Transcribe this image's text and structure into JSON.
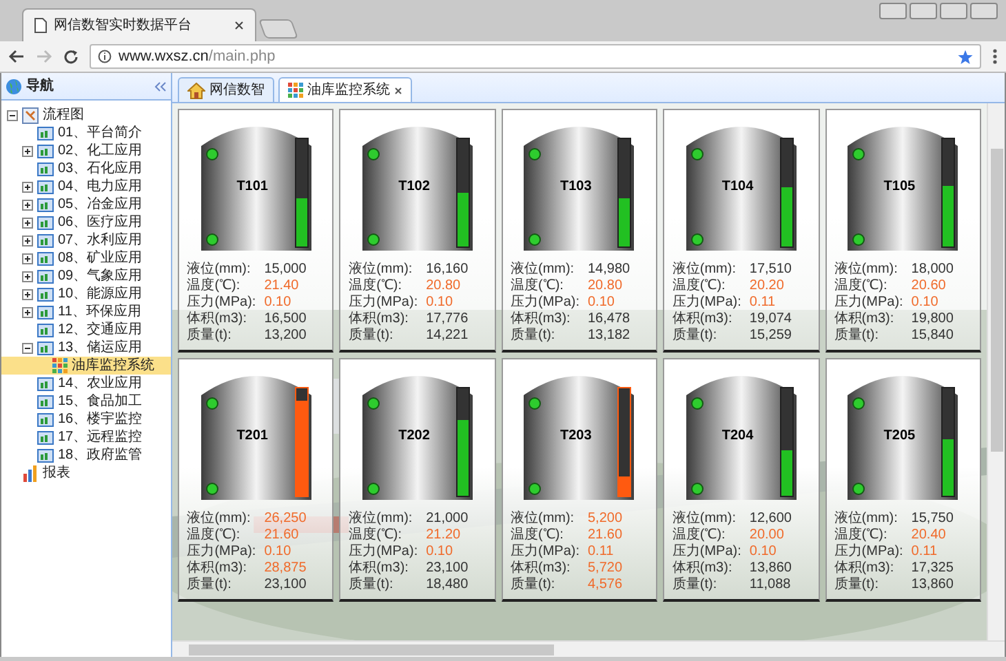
{
  "browser": {
    "tab_title": "网信数智实时数据平台",
    "url_host": "www.wxsz.cn",
    "url_path": "/main.php"
  },
  "sidebar": {
    "title": "导航",
    "tree": [
      {
        "label": "流程图",
        "kind": "flow",
        "expanded": true,
        "selected": false,
        "children": [
          {
            "label": "01、平台简介",
            "kind": "page",
            "selected": false
          },
          {
            "label": "02、化工应用",
            "kind": "page",
            "expanded": false,
            "selected": false
          },
          {
            "label": "03、石化应用",
            "kind": "page",
            "selected": false
          },
          {
            "label": "04、电力应用",
            "kind": "page",
            "expanded": false,
            "selected": false
          },
          {
            "label": "05、冶金应用",
            "kind": "page",
            "expanded": false,
            "selected": false
          },
          {
            "label": "06、医疗应用",
            "kind": "page",
            "expanded": false,
            "selected": false
          },
          {
            "label": "07、水利应用",
            "kind": "page",
            "expanded": false,
            "selected": false
          },
          {
            "label": "08、矿业应用",
            "kind": "page",
            "expanded": false,
            "selected": false
          },
          {
            "label": "09、气象应用",
            "kind": "page",
            "expanded": false,
            "selected": false
          },
          {
            "label": "10、能源应用",
            "kind": "page",
            "expanded": false,
            "selected": false
          },
          {
            "label": "11、环保应用",
            "kind": "page",
            "expanded": false,
            "selected": false
          },
          {
            "label": "12、交通应用",
            "kind": "page",
            "selected": false
          },
          {
            "label": "13、储运应用",
            "kind": "page",
            "expanded": true,
            "selected": false,
            "children": [
              {
                "label": "油库监控系统",
                "kind": "grid",
                "selected": true
              }
            ]
          },
          {
            "label": "14、农业应用",
            "kind": "page",
            "selected": false
          },
          {
            "label": "15、食品加工",
            "kind": "page",
            "selected": false
          },
          {
            "label": "16、楼宇监控",
            "kind": "page",
            "selected": false
          },
          {
            "label": "17、远程监控",
            "kind": "page",
            "selected": false
          },
          {
            "label": "18、政府监管",
            "kind": "page",
            "selected": false
          }
        ]
      },
      {
        "label": "报表",
        "kind": "report",
        "selected": false
      }
    ]
  },
  "tabs": [
    {
      "label": "网信数智",
      "kind": "home",
      "selected": false
    },
    {
      "label": "油库监控系统",
      "kind": "grid",
      "selected": true
    }
  ],
  "tanks": [
    {
      "name": "T101",
      "level": 0.45,
      "alarm": false,
      "readings": [
        {
          "label": "液位(mm):",
          "value": "15,000",
          "alert": false
        },
        {
          "label": "温度(℃):",
          "value": "21.40",
          "alert": true
        },
        {
          "label": "压力(MPa):",
          "value": "0.10",
          "alert": true
        },
        {
          "label": "体积(m3):",
          "value": "16,500",
          "alert": false
        },
        {
          "label": "质量(t):",
          "value": "13,200",
          "alert": false
        }
      ]
    },
    {
      "name": "T102",
      "level": 0.5,
      "alarm": false,
      "readings": [
        {
          "label": "液位(mm):",
          "value": "16,160",
          "alert": false
        },
        {
          "label": "温度(℃):",
          "value": "20.80",
          "alert": true
        },
        {
          "label": "压力(MPa):",
          "value": "0.10",
          "alert": true
        },
        {
          "label": "体积(m3):",
          "value": "17,776",
          "alert": false
        },
        {
          "label": "质量(t):",
          "value": "14,221",
          "alert": false
        }
      ]
    },
    {
      "name": "T103",
      "level": 0.45,
      "alarm": false,
      "readings": [
        {
          "label": "液位(mm):",
          "value": "14,980",
          "alert": false
        },
        {
          "label": "温度(℃):",
          "value": "20.80",
          "alert": true
        },
        {
          "label": "压力(MPa):",
          "value": "0.10",
          "alert": true
        },
        {
          "label": "体积(m3):",
          "value": "16,478",
          "alert": false
        },
        {
          "label": "质量(t):",
          "value": "13,182",
          "alert": false
        }
      ]
    },
    {
      "name": "T104",
      "level": 0.55,
      "alarm": false,
      "readings": [
        {
          "label": "液位(mm):",
          "value": "17,510",
          "alert": false
        },
        {
          "label": "温度(℃):",
          "value": "20.20",
          "alert": true
        },
        {
          "label": "压力(MPa):",
          "value": "0.11",
          "alert": true
        },
        {
          "label": "体积(m3):",
          "value": "19,074",
          "alert": false
        },
        {
          "label": "质量(t):",
          "value": "15,259",
          "alert": false
        }
      ]
    },
    {
      "name": "T105",
      "level": 0.57,
      "alarm": false,
      "readings": [
        {
          "label": "液位(mm):",
          "value": "18,000",
          "alert": false
        },
        {
          "label": "温度(℃):",
          "value": "20.60",
          "alert": true
        },
        {
          "label": "压力(MPa):",
          "value": "0.10",
          "alert": true
        },
        {
          "label": "体积(m3):",
          "value": "19,800",
          "alert": false
        },
        {
          "label": "质量(t):",
          "value": "15,840",
          "alert": false
        }
      ]
    },
    {
      "name": "T201",
      "level": 0.88,
      "alarm": true,
      "readings": [
        {
          "label": "液位(mm):",
          "value": "26,250",
          "alert": true
        },
        {
          "label": "温度(℃):",
          "value": "21.60",
          "alert": true
        },
        {
          "label": "压力(MPa):",
          "value": "0.10",
          "alert": true
        },
        {
          "label": "体积(m3):",
          "value": "28,875",
          "alert": true
        },
        {
          "label": "质量(t):",
          "value": "23,100",
          "alert": false
        }
      ]
    },
    {
      "name": "T202",
      "level": 0.7,
      "alarm": false,
      "readings": [
        {
          "label": "液位(mm):",
          "value": "21,000",
          "alert": false
        },
        {
          "label": "温度(℃):",
          "value": "21.20",
          "alert": true
        },
        {
          "label": "压力(MPa):",
          "value": "0.10",
          "alert": true
        },
        {
          "label": "体积(m3):",
          "value": "23,100",
          "alert": false
        },
        {
          "label": "质量(t):",
          "value": "18,480",
          "alert": false
        }
      ]
    },
    {
      "name": "T203",
      "level": 0.18,
      "alarm": true,
      "readings": [
        {
          "label": "液位(mm):",
          "value": "5,200",
          "alert": true
        },
        {
          "label": "温度(℃):",
          "value": "21.60",
          "alert": true
        },
        {
          "label": "压力(MPa):",
          "value": "0.11",
          "alert": true
        },
        {
          "label": "体积(m3):",
          "value": "5,720",
          "alert": true
        },
        {
          "label": "质量(t):",
          "value": "4,576",
          "alert": true
        }
      ]
    },
    {
      "name": "T204",
      "level": 0.42,
      "alarm": false,
      "readings": [
        {
          "label": "液位(mm):",
          "value": "12,600",
          "alert": false
        },
        {
          "label": "温度(℃):",
          "value": "20.00",
          "alert": true
        },
        {
          "label": "压力(MPa):",
          "value": "0.10",
          "alert": true
        },
        {
          "label": "体积(m3):",
          "value": "13,860",
          "alert": false
        },
        {
          "label": "质量(t):",
          "value": "11,088",
          "alert": false
        }
      ]
    },
    {
      "name": "T205",
      "level": 0.52,
      "alarm": false,
      "readings": [
        {
          "label": "液位(mm):",
          "value": "15,750",
          "alert": false
        },
        {
          "label": "温度(℃):",
          "value": "20.40",
          "alert": true
        },
        {
          "label": "压力(MPa):",
          "value": "0.11",
          "alert": true
        },
        {
          "label": "体积(m3):",
          "value": "17,325",
          "alert": false
        },
        {
          "label": "质量(t):",
          "value": "13,860",
          "alert": false
        }
      ]
    }
  ]
}
